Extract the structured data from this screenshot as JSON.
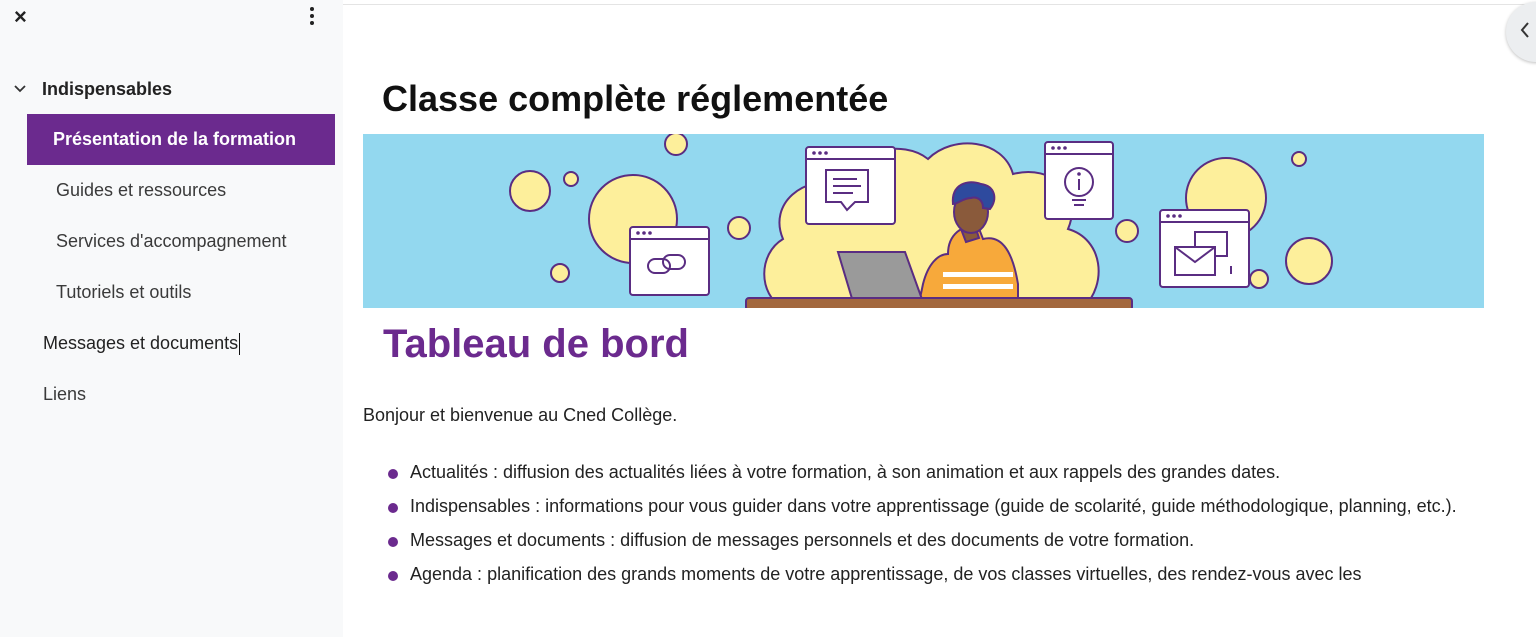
{
  "sidebar": {
    "close_label": "×",
    "section": {
      "label": "Indispensables",
      "expanded": true
    },
    "sub_items": [
      {
        "label": "Présentation de la formation",
        "active": true
      },
      {
        "label": "Guides et ressources",
        "active": false
      },
      {
        "label": "Services d'accompagnement",
        "active": false
      },
      {
        "label": "Tutoriels et outils",
        "active": false
      }
    ],
    "top_items": [
      {
        "label": "Messages et documents"
      },
      {
        "label": "Liens"
      }
    ]
  },
  "main": {
    "page_title": "Classe complète réglementée",
    "dashboard_title": "Tableau de bord",
    "intro": "Bonjour et bienvenue au Cned Collège.",
    "bullets": [
      "Actualités : diffusion des actualités liées à votre formation, à son animation et aux rappels des grandes dates.",
      "Indispensables : informations pour vous guider dans votre apprentissage (guide de scolarité, guide méthodologique, planning, etc.).",
      "Messages et documents : diffusion de messages personnels et des documents de votre formation.",
      "Agenda : planification des grands moments de votre apprentissage, de vos classes virtuelles, des rendez-vous avec les"
    ]
  },
  "colors": {
    "accent": "#6b2a8e",
    "banner_bg": "#93d8ef",
    "banner_yellow": "#fdef9b"
  },
  "icons": {
    "close": "close-icon",
    "menu": "kebab-menu-icon",
    "expand": "chevron-down-icon",
    "collapse_panel": "chevron-left-icon"
  }
}
